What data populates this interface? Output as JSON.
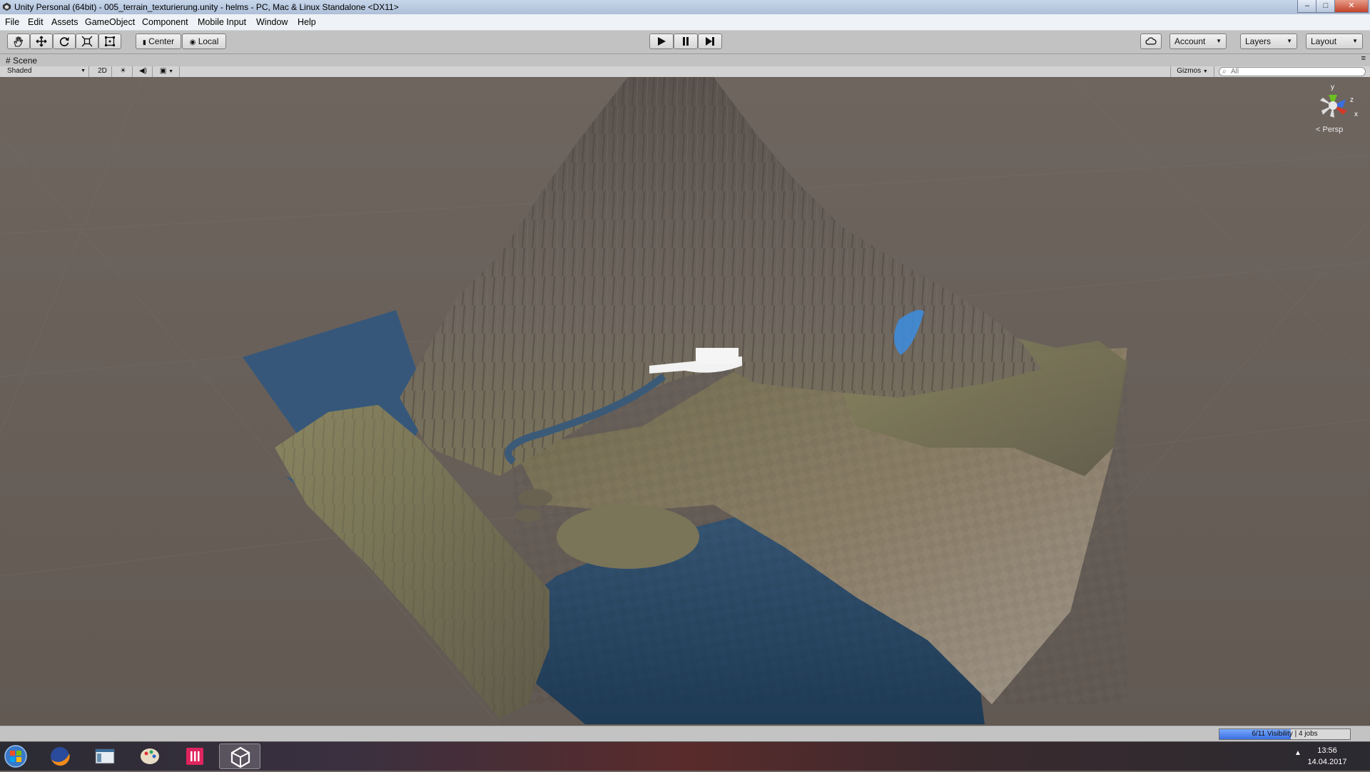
{
  "window": {
    "title": "Unity Personal (64bit) - 005_terrain_texturierung.unity - helms - PC, Mac & Linux Standalone <DX11>",
    "min_label": "–",
    "max_label": "□",
    "close_label": "✕"
  },
  "menu": [
    "File",
    "Edit",
    "Assets",
    "GameObject",
    "Component",
    "Mobile Input",
    "Window",
    "Help"
  ],
  "toolbar": {
    "tools": [
      "hand-tool",
      "move-tool",
      "rotate-tool",
      "scale-tool",
      "rect-tool"
    ],
    "pivot_label": "Center",
    "space_label": "Local",
    "account_label": "Account",
    "layers_label": "Layers",
    "layout_label": "Layout"
  },
  "scene": {
    "tab_label": "Scene",
    "shading_label": "Shaded",
    "mode_2d_label": "2D",
    "gizmos_label": "Gizmos",
    "search_placeholder": "All",
    "persp_label": "Persp",
    "axis_labels": {
      "y": "y",
      "z": "z",
      "x": "x"
    }
  },
  "status": {
    "progress_text": "6/11 Visibility | 4 jobs",
    "progress_fraction": 0.545
  },
  "taskbar": {
    "apps": [
      "start-button",
      "firefox",
      "explorer",
      "paint",
      "flag-app",
      "unity"
    ],
    "time": "13:56",
    "date": "14.04.2017"
  },
  "colors": {
    "viewport_bg": "#6b625c",
    "water": "#2d4f6e",
    "terrain": "#7d7457"
  }
}
